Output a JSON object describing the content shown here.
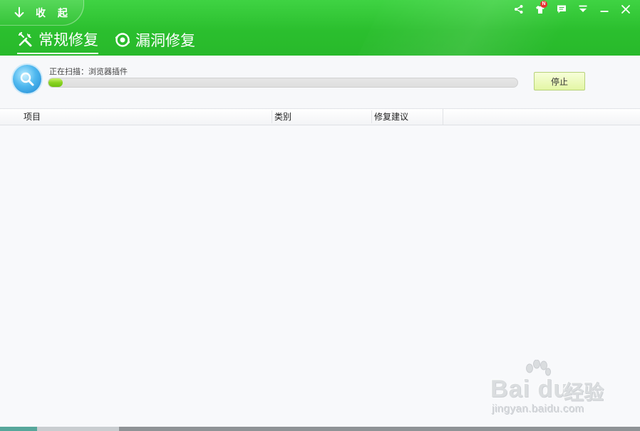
{
  "header": {
    "collapse_label": "收 起",
    "tabs": [
      {
        "label": "常规修复",
        "active": true,
        "icon": "wrench-screwdriver-icon"
      },
      {
        "label": "漏洞修复",
        "active": false,
        "icon": "shield-patch-icon"
      }
    ],
    "controls": {
      "share_icon": "share-icon",
      "skin_icon": "tshirt-icon",
      "skin_badge": "N",
      "feedback_icon": "message-icon",
      "menu_icon": "dropdown-menu-icon",
      "minimize_icon": "minimize-icon",
      "close_icon": "close-icon"
    },
    "accent_color": "#2bbf2e"
  },
  "scan": {
    "status_text": "正在扫描：浏览器插件",
    "progress_percent": 3,
    "stop_label": "停止",
    "icon": "magnifier-scan-icon"
  },
  "table": {
    "columns": [
      "项目",
      "类别",
      "修复建议"
    ],
    "rows": []
  },
  "watermark": {
    "brand": "Bai du",
    "brand_cn": "经验",
    "url": "jingyan.baidu.com"
  }
}
